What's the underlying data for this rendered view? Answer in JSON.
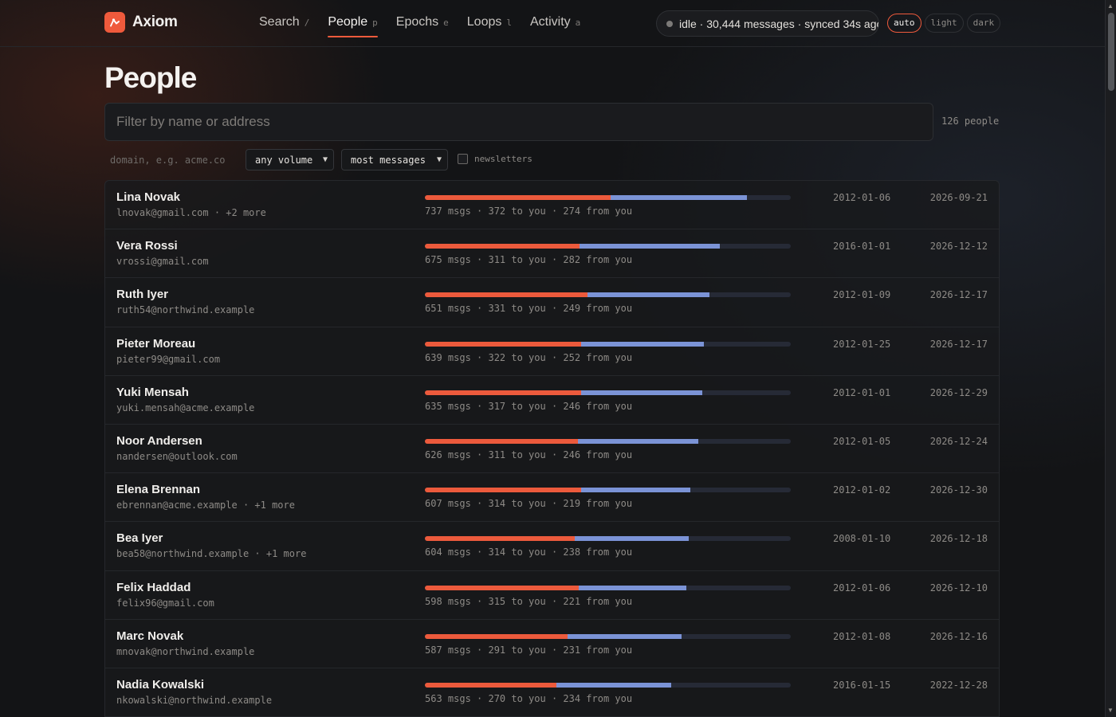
{
  "brand": {
    "name": "Axiom",
    "accent": "#ef5a3c"
  },
  "nav": [
    {
      "label": "Search",
      "key": "/",
      "active": false
    },
    {
      "label": "People",
      "key": "p",
      "active": true
    },
    {
      "label": "Epochs",
      "key": "e",
      "active": false
    },
    {
      "label": "Loops",
      "key": "l",
      "active": false
    },
    {
      "label": "Activity",
      "key": "a",
      "active": false
    }
  ],
  "status": {
    "text": "idle · 30,444 messages · synced 34s ago"
  },
  "theme": {
    "options": [
      "auto",
      "light",
      "dark"
    ],
    "selected": "auto"
  },
  "page": {
    "title": "People"
  },
  "filters": {
    "search_placeholder": "Filter by name or address",
    "count": "126 people",
    "domain_placeholder": "domain, e.g. acme.co",
    "volume": "any volume",
    "sort": "most messages",
    "newsletters_label": "newsletters",
    "newsletters_checked": false
  },
  "colors": {
    "to_you": "#ec5a3c",
    "from_you": "#7b93d6",
    "bar_track": "#262a36"
  },
  "people": [
    {
      "name": "Lina Novak",
      "address": "lnovak@gmail.com · +2 more",
      "msgs": 737,
      "to_you": 372,
      "from_you": 274,
      "stats": "737 msgs · 372 to you · 274 from you",
      "first": "2012-01-06",
      "last": "2026-09-21"
    },
    {
      "name": "Vera Rossi",
      "address": "vrossi@gmail.com",
      "msgs": 675,
      "to_you": 311,
      "from_you": 282,
      "stats": "675 msgs · 311 to you · 282 from you",
      "first": "2016-01-01",
      "last": "2026-12-12"
    },
    {
      "name": "Ruth Iyer",
      "address": "ruth54@northwind.example",
      "msgs": 651,
      "to_you": 331,
      "from_you": 249,
      "stats": "651 msgs · 331 to you · 249 from you",
      "first": "2012-01-09",
      "last": "2026-12-17"
    },
    {
      "name": "Pieter Moreau",
      "address": "pieter99@gmail.com",
      "msgs": 639,
      "to_you": 322,
      "from_you": 252,
      "stats": "639 msgs · 322 to you · 252 from you",
      "first": "2012-01-25",
      "last": "2026-12-17"
    },
    {
      "name": "Yuki Mensah",
      "address": "yuki.mensah@acme.example",
      "msgs": 635,
      "to_you": 317,
      "from_you": 246,
      "stats": "635 msgs · 317 to you · 246 from you",
      "first": "2012-01-01",
      "last": "2026-12-29"
    },
    {
      "name": "Noor Andersen",
      "address": "nandersen@outlook.com",
      "msgs": 626,
      "to_you": 311,
      "from_you": 246,
      "stats": "626 msgs · 311 to you · 246 from you",
      "first": "2012-01-05",
      "last": "2026-12-24"
    },
    {
      "name": "Elena Brennan",
      "address": "ebrennan@acme.example · +1 more",
      "msgs": 607,
      "to_you": 314,
      "from_you": 219,
      "stats": "607 msgs · 314 to you · 219 from you",
      "first": "2012-01-02",
      "last": "2026-12-30"
    },
    {
      "name": "Bea Iyer",
      "address": "bea58@northwind.example · +1 more",
      "msgs": 604,
      "to_you": 314,
      "from_you": 238,
      "stats": "604 msgs · 314 to you · 238 from you",
      "first": "2008-01-10",
      "last": "2026-12-18"
    },
    {
      "name": "Felix Haddad",
      "address": "felix96@gmail.com",
      "msgs": 598,
      "to_you": 315,
      "from_you": 221,
      "stats": "598 msgs · 315 to you · 221 from you",
      "first": "2012-01-06",
      "last": "2026-12-10"
    },
    {
      "name": "Marc Novak",
      "address": "mnovak@northwind.example",
      "msgs": 587,
      "to_you": 291,
      "from_you": 231,
      "stats": "587 msgs · 291 to you · 231 from you",
      "first": "2012-01-08",
      "last": "2026-12-16"
    },
    {
      "name": "Nadia Kowalski",
      "address": "nkowalski@northwind.example",
      "msgs": 563,
      "to_you": 270,
      "from_you": 234,
      "stats": "563 msgs · 270 to you · 234 from you",
      "first": "2016-01-15",
      "last": "2022-12-28"
    }
  ]
}
